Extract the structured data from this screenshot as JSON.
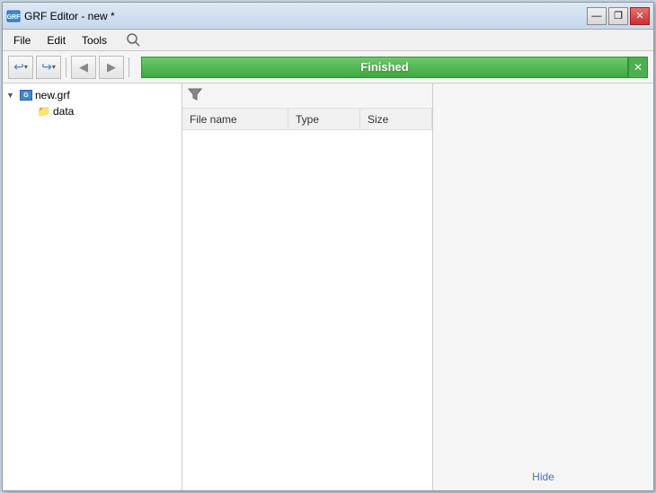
{
  "window": {
    "title": "GRF Editor - new *",
    "subtitle": "grf-editor-window"
  },
  "titlebar": {
    "title": "GRF Editor - new *",
    "minimize_label": "—",
    "restore_label": "❐",
    "close_label": "✕"
  },
  "menubar": {
    "items": [
      {
        "label": "File"
      },
      {
        "label": "Edit"
      },
      {
        "label": "Tools"
      }
    ]
  },
  "toolbar": {
    "undo_label": "↩",
    "undo_arrow": "▾",
    "redo_label": "↪",
    "redo_arrow": "▾",
    "btn3_label": "◀",
    "btn4_label": "▶"
  },
  "progress": {
    "label": "Finished",
    "close_label": "✕",
    "background_color": "#4caf50"
  },
  "filetree": {
    "root": {
      "label": "new.grf",
      "expanded": true
    },
    "children": [
      {
        "label": "data",
        "type": "folder"
      }
    ]
  },
  "filelist": {
    "filter_tooltip": "Filter",
    "columns": [
      {
        "label": "File name"
      },
      {
        "label": "Type"
      },
      {
        "label": "Size"
      }
    ],
    "rows": []
  },
  "preview": {
    "hide_label": "Hide"
  }
}
